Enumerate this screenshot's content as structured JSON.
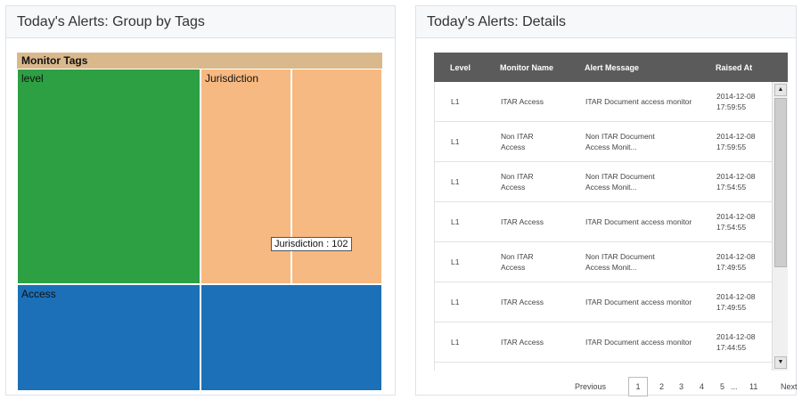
{
  "left_panel": {
    "title": "Today's Alerts: Group by Tags",
    "treemap": {
      "header": "Monitor Tags",
      "cells": {
        "level": "level",
        "jurisdiction": "Jurisdiction",
        "access": "Access"
      },
      "colors": {
        "level": "#2ea044",
        "jurisdiction": "#f6b981",
        "access": "#1c70b8",
        "header": "#d9b98c"
      },
      "tooltip": "Jurisdiction : 102"
    }
  },
  "right_panel": {
    "title": "Today's Alerts: Details",
    "columns": [
      "Level",
      "Monitor Name",
      "Alert Message",
      "Raised At"
    ],
    "rows": [
      {
        "level": "L1",
        "name": "ITAR Access",
        "msg": "ITAR Document access monitor",
        "date": "2014-12-08",
        "time": "17:59:55"
      },
      {
        "level": "L1",
        "name": "Non ITAR Access",
        "msg": "Non ITAR Document Access Monit...",
        "date": "2014-12-08",
        "time": "17:59:55"
      },
      {
        "level": "L1",
        "name": "Non ITAR Access",
        "msg": "Non ITAR Document Access Monit...",
        "date": "2014-12-08",
        "time": "17:54:55"
      },
      {
        "level": "L1",
        "name": "ITAR Access",
        "msg": "ITAR Document access monitor",
        "date": "2014-12-08",
        "time": "17:54:55"
      },
      {
        "level": "L1",
        "name": "Non ITAR Access",
        "msg": "Non ITAR Document Access Monit...",
        "date": "2014-12-08",
        "time": "17:49:55"
      },
      {
        "level": "L1",
        "name": "ITAR Access",
        "msg": "ITAR Document access monitor",
        "date": "2014-12-08",
        "time": "17:49:55"
      },
      {
        "level": "L1",
        "name": "ITAR Access",
        "msg": "ITAR Document access monitor",
        "date": "2014-12-08",
        "time": "17:44:55"
      }
    ],
    "pager": {
      "previous": "Previous",
      "pages": [
        "1",
        "2",
        "3",
        "4",
        "5",
        "...",
        "11"
      ],
      "next": "Next",
      "current": "1"
    },
    "scroll_icons": {
      "up": "triangle-up-icon",
      "down": "triangle-down-icon"
    }
  }
}
